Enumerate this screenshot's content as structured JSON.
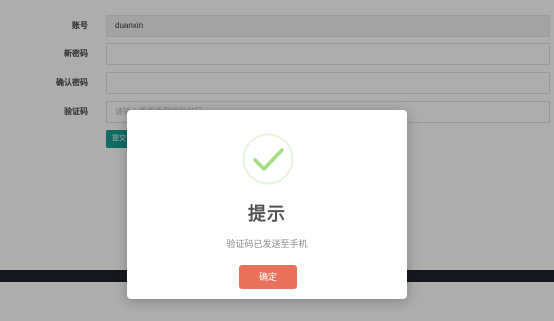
{
  "form": {
    "account": {
      "label": "账号",
      "value": "duanxin"
    },
    "new_password": {
      "label": "新密码",
      "value": ""
    },
    "confirm_password": {
      "label": "确认密码",
      "value": ""
    },
    "captcha": {
      "label": "验证码",
      "placeholder": "请输入手机收到的验证码"
    },
    "submit_label": "提交"
  },
  "dialog": {
    "icon": "check-circle-icon",
    "title": "提示",
    "message": "验证码已发送至手机",
    "confirm_label": "确定",
    "accent_color": "#a5dc86",
    "button_color": "#e8715a"
  }
}
